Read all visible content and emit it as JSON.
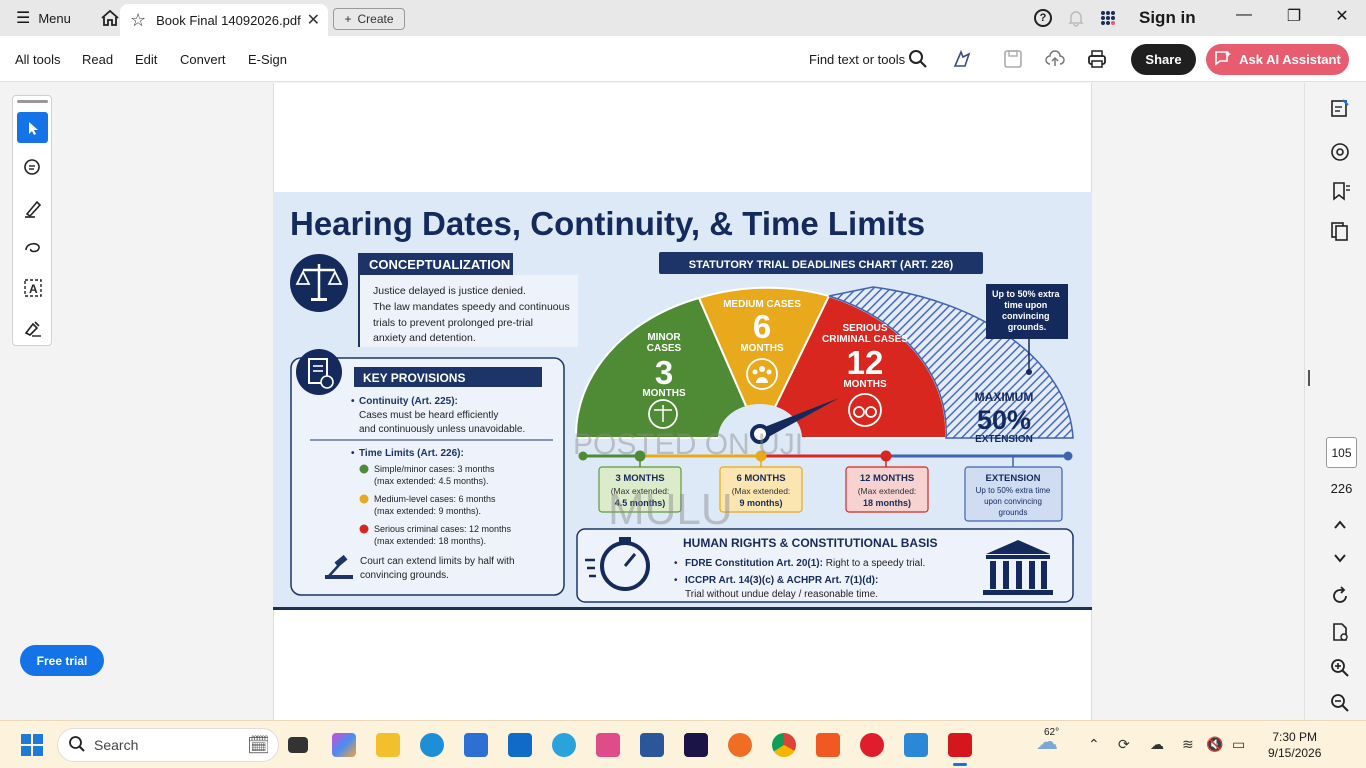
{
  "titlebar": {
    "menu_label": "Menu",
    "tab_title": "Book Final 14092026.pdf",
    "create_label": "Create",
    "signin_label": "Sign in"
  },
  "toolbar": {
    "menus": [
      "All tools",
      "Read",
      "Edit",
      "Convert",
      "E-Sign"
    ],
    "find_label": "Find text or tools",
    "share_label": "Share",
    "ai_label": "Ask AI Assistant"
  },
  "left": {
    "free_trial": "Free trial"
  },
  "nav": {
    "current_page": "105",
    "total_pages": "226"
  },
  "infographic": {
    "title": "Hearing Dates, Continuity, & Time Limits",
    "concept_header": "CONCEPTUALIZATION",
    "concept_lines": [
      "Justice delayed is justice denied.",
      "The law mandates speedy and continuous",
      "trials to prevent prolonged pre-trial",
      "anxiety and detention."
    ],
    "key_header": "KEY PROVISIONS",
    "continuity_title": "Continuity (Art. 225):",
    "continuity_lines": [
      "Cases must be heard efficiently",
      "and continuously unless unavoidable."
    ],
    "limits_title": "Time Limits (Art. 226):",
    "limits": [
      {
        "a": "Simple/minor cases: 3 months",
        "b": "(max extended: 4.5 months).",
        "color": "#4f8a34"
      },
      {
        "a": "Medium-level cases: 6 months",
        "b": "(max extended: 9 months).",
        "color": "#e9a91c"
      },
      {
        "a": "Serious criminal cases:  12 months",
        "b": "(max extended: 18 months).",
        "color": "#d8271f"
      }
    ],
    "extend_lines": [
      "Court can extend limits by half with",
      "convincing grounds."
    ],
    "chart_header": "STATUTORY TRIAL DEADLINES CHART (ART. 226)",
    "seg_minor": {
      "l1": "MINOR",
      "l2": "CASES",
      "num": "3",
      "unit": "MONTHS"
    },
    "seg_medium": {
      "l1": "MEDIUM CASES",
      "num": "6",
      "unit": "MONTHS"
    },
    "seg_serious": {
      "l1": "SERIOUS",
      "l2": "CRIMINAL CASES",
      "num": "12",
      "unit": "MONTHS"
    },
    "seg_max": {
      "l1": "MAXIMUM",
      "num": "50%",
      "unit": "EXTENSION"
    },
    "callout": [
      "Up to 50% extra",
      "time upon",
      "convincing",
      "grounds."
    ],
    "boxes": [
      {
        "t": "3 MONTHS",
        "a": "(Max extended:",
        "b": "4.5 months)",
        "bg": "#dcebc9",
        "bd": "#5d9a3f"
      },
      {
        "t": "6 MONTHS",
        "a": "(Max extended:",
        "b": "9 months)",
        "bg": "#fbe5b0",
        "bd": "#e9a91c"
      },
      {
        "t": "12 MONTHS",
        "a": "(Max extended:",
        "b": "18 months)",
        "bg": "#f6d3d1",
        "bd": "#d8271f"
      },
      {
        "t": "EXTENSION",
        "a": "Up to 50% extra time",
        "b": "upon convincing",
        "c": "grounds",
        "bg": "#cfdcf2",
        "bd": "#3f63b3"
      }
    ],
    "hr_header": "HUMAN RIGHTS & CONSTITUTIONAL BASIS",
    "hr1_bold": "FDRE Constitution Art. 20(1):",
    "hr1_rest": " Right to a speedy trial.",
    "hr2_bold": "ICCPR Art. 14(3)(c) & ACHPR Art. 7(1)(d):",
    "hr2_rest": "Trial without undue delay / reasonable time.",
    "watermark1": "POSTED ON UJI",
    "watermark2": "MULU"
  },
  "taskbar": {
    "search_placeholder": "Search",
    "temperature": "62°",
    "time": "7:30 PM",
    "date": "9/15/2026"
  }
}
